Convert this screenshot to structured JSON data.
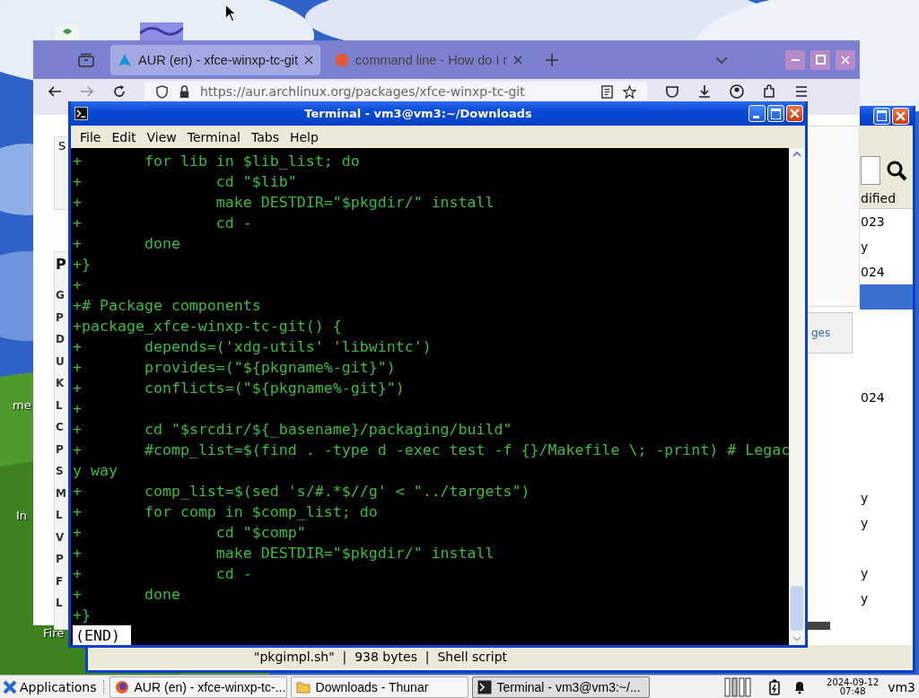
{
  "desktop": {
    "icons": [
      {
        "label": "me"
      },
      {
        "label": "In"
      },
      {
        "label": "Fire"
      }
    ]
  },
  "browser": {
    "tabs": [
      {
        "title": "AUR (en) - xfce-winxp-tc-git",
        "selected": true,
        "kind": "arch"
      },
      {
        "title": "command line - How do I r",
        "selected": false,
        "kind": "ask"
      }
    ],
    "url": "https://aur.archlinux.org/packages/xfce-winxp-tc-git",
    "search_label": "S",
    "details_heading": "P",
    "detail_labels": [
      "G",
      "P",
      "D",
      "U",
      "K",
      "L",
      "C",
      "P",
      "S",
      "M",
      "L",
      "V",
      "P",
      "F",
      "L"
    ],
    "side_link": "ges"
  },
  "file_manager": {
    "column_header": "dified",
    "rows": [
      {
        "modified": "023",
        "selected": false
      },
      {
        "modified": "y",
        "selected": false
      },
      {
        "modified": "024",
        "selected": false
      },
      {
        "selected": true
      },
      {
        "selected": false
      },
      {
        "selected": false
      },
      {
        "selected": false
      },
      {
        "modified": "024",
        "selected": false
      },
      {
        "selected": false
      },
      {
        "selected": false
      },
      {
        "selected": false
      },
      {
        "modified": "y",
        "selected": false
      },
      {
        "modified": "y",
        "selected": false
      },
      {
        "selected": false
      },
      {
        "modified": "y",
        "selected": false
      },
      {
        "modified": "y",
        "selected": false
      }
    ],
    "status": "\"pkgimpl.sh\"  |  938 bytes  |  Shell script"
  },
  "terminal": {
    "title": "Terminal - vm3@vm3:~/Downloads",
    "menu": [
      "File",
      "Edit",
      "View",
      "Terminal",
      "Tabs",
      "Help"
    ],
    "lines": [
      "+\tfor lib in $lib_list; do",
      "+\t\tcd \"$lib\"",
      "+\t\tmake DESTDIR=\"$pkgdir/\" install",
      "+\t\tcd -",
      "+\tdone",
      "+}",
      "+",
      "+# Package components",
      "+package_xfce-winxp-tc-git() {",
      "+\tdepends=('xdg-utils' 'libwintc')",
      "+\tprovides=(\"${pkgname%-git}\")",
      "+\tconflicts=(\"${pkgname%-git}\")",
      "+",
      "+\tcd \"$srcdir/${_basename}/packaging/build\"",
      "+\t#comp_list=$(find . -type d -exec test -f {}/Makefile \\; -print) # Legac",
      "y way",
      "+\tcomp_list=$(sed 's/#.*$//g' < \"../targets\")",
      "+\tfor comp in $comp_list; do",
      "+\t\tcd \"$comp\"",
      "+\t\tmake DESTDIR=\"$pkgdir/\" install",
      "+\t\tcd -",
      "+\tdone",
      "+}"
    ],
    "pager_prompt": "(END)"
  },
  "taskbar": {
    "start_label": "Applications",
    "tasks": [
      {
        "kind": "browser",
        "label": "AUR (en) - xfce-winxp-tc-...",
        "selected": false
      },
      {
        "kind": "folder",
        "label": "Downloads - Thunar",
        "selected": false
      },
      {
        "kind": "terminal",
        "label": "Terminal - vm3@vm3:~/...",
        "selected": true
      }
    ],
    "date": "2024-09-12",
    "time": "07:48",
    "user": "vm3"
  }
}
